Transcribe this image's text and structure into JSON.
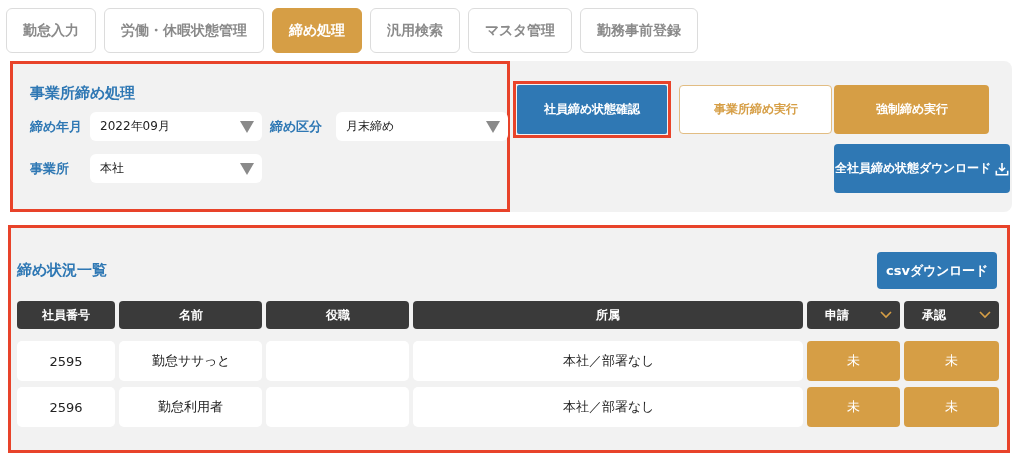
{
  "tabs": [
    {
      "label": "勤怠入力",
      "selected": false
    },
    {
      "label": "労働・休暇状態管理",
      "selected": false
    },
    {
      "label": "締め処理",
      "selected": true
    },
    {
      "label": "汎用検索",
      "selected": false
    },
    {
      "label": "マスタ管理",
      "selected": false
    },
    {
      "label": "勤務事前登録",
      "selected": false
    }
  ],
  "closing_panel": {
    "title": "事業所締め処理",
    "highlighted": true,
    "fields": [
      {
        "label": "締め年月",
        "value": "2022年09月"
      },
      {
        "label": "締め区分",
        "value": "月末締め"
      },
      {
        "label": "事業所",
        "value": "本社"
      }
    ]
  },
  "actions": [
    {
      "label": "社員締め状態確認",
      "kind": "primary",
      "highlighted": true
    },
    {
      "label": "事業所締め実行",
      "kind": "outline",
      "highlighted": false
    },
    {
      "label": "強制締め実行",
      "kind": "warning",
      "highlighted": false
    },
    {
      "label": "全社員締め状態ダウンロード",
      "kind": "download",
      "highlighted": false
    }
  ],
  "list_panel": {
    "title": "締め状況一覧",
    "highlighted": true,
    "download_button": "csvダウンロード",
    "columns": [
      {
        "label": "社員番号",
        "has_menu": false
      },
      {
        "label": "名前",
        "has_menu": false
      },
      {
        "label": "役職",
        "has_menu": false
      },
      {
        "label": "所属",
        "has_menu": false
      },
      {
        "label": "申請",
        "has_menu": true
      },
      {
        "label": "承認",
        "has_menu": true
      }
    ],
    "rows": [
      {
        "employee_no": "2595",
        "name": "勤怠ササっと",
        "affiliation": "本社／部署なし",
        "application": "未",
        "approval": "未"
      },
      {
        "employee_no": "2596",
        "name": "勤怠利用者",
        "affiliation": "本社／部署なし",
        "application": "未",
        "approval": "未"
      }
    ]
  }
}
